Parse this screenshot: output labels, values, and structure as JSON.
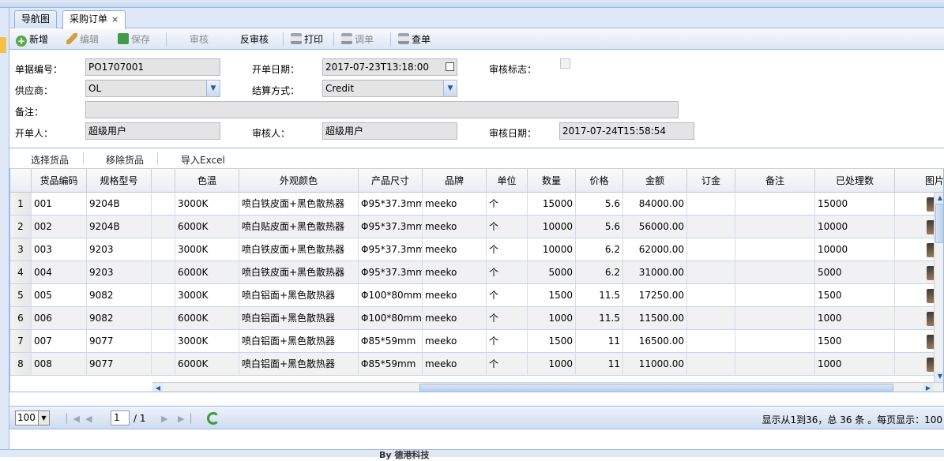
{
  "tabs": [
    {
      "label": "导航图",
      "closable": false
    },
    {
      "label": "采购订单",
      "closable": true
    }
  ],
  "tab_close_glyph": "×",
  "toolbar": {
    "add": "新增",
    "edit": "编辑",
    "save": "保存",
    "audit": "审核",
    "unaudit": "反审核",
    "print": "打印",
    "adjust": "调单",
    "query": "查单"
  },
  "form": {
    "doc_no_label": "单据编号：",
    "doc_no": "PO1707001",
    "open_date_label": "开单日期：",
    "open_date": "2017-07-23T13:18:00",
    "audit_flag_label": "审核标志：",
    "supplier_label": "供应商：",
    "supplier": "OL",
    "settle_label": "结算方式：",
    "settle": "Credit",
    "remark_label": "备注：",
    "remark": "",
    "creator_label": "开单人：",
    "creator": "超级用户",
    "auditor_label": "审核人：",
    "auditor": "超级用户",
    "audit_date_label": "审核日期：",
    "audit_date": "2017-07-24T15:58:54"
  },
  "grid_toolbar": {
    "select": "选择货品",
    "remove": "移除货品",
    "import": "导入Excel"
  },
  "grid": {
    "headers": [
      "",
      "货品编码",
      "规格型号",
      "",
      "色温",
      "外观颜色",
      "产品尺寸",
      "品牌",
      "单位",
      "数量",
      "价格",
      "金额",
      "订金",
      "备注",
      "已处理数",
      "图片"
    ],
    "rows": [
      {
        "n": "1",
        "code": "001",
        "model": "9204B",
        "temp": "3000K",
        "color": "喷白铁皮面+黑色散热器",
        "size": "Φ95*37.3mm",
        "brand": "meeko",
        "unit": "个",
        "qty": "15000",
        "price": "5.6",
        "amount": "84000.00",
        "deposit": "",
        "remark": "",
        "done": "15000"
      },
      {
        "n": "2",
        "code": "002",
        "model": "9204B",
        "temp": "6000K",
        "color": "喷白贴皮面+黑色散热器",
        "size": "Φ95*37.3mm",
        "brand": "meeko",
        "unit": "个",
        "qty": "10000",
        "price": "5.6",
        "amount": "56000.00",
        "deposit": "",
        "remark": "",
        "done": "10000"
      },
      {
        "n": "3",
        "code": "003",
        "model": "9203",
        "temp": "3000K",
        "color": "喷白铁皮面+黑色散热器",
        "size": "Φ95*37.3mm",
        "brand": "meeko",
        "unit": "个",
        "qty": "10000",
        "price": "6.2",
        "amount": "62000.00",
        "deposit": "",
        "remark": "",
        "done": "10000"
      },
      {
        "n": "4",
        "code": "004",
        "model": "9203",
        "temp": "6000K",
        "color": "喷白铁皮面+黑色散热器",
        "size": "Φ95*37.3mm",
        "brand": "meeko",
        "unit": "个",
        "qty": "5000",
        "price": "6.2",
        "amount": "31000.00",
        "deposit": "",
        "remark": "",
        "done": "5000"
      },
      {
        "n": "5",
        "code": "005",
        "model": "9082",
        "temp": "3000K",
        "color": "喷白铝面+黑色散热器",
        "size": "Φ100*80mm",
        "brand": "meeko",
        "unit": "个",
        "qty": "1500",
        "price": "11.5",
        "amount": "17250.00",
        "deposit": "",
        "remark": "",
        "done": "1500"
      },
      {
        "n": "6",
        "code": "006",
        "model": "9082",
        "temp": "6000K",
        "color": "喷白铝面+黑色散热器",
        "size": "Φ100*80mm",
        "brand": "meeko",
        "unit": "个",
        "qty": "1000",
        "price": "11.5",
        "amount": "11500.00",
        "deposit": "",
        "remark": "",
        "done": "1000"
      },
      {
        "n": "7",
        "code": "007",
        "model": "9077",
        "temp": "3000K",
        "color": "喷白铝面+黑色散热器",
        "size": "Φ85*59mm",
        "brand": "meeko",
        "unit": "个",
        "qty": "1500",
        "price": "11",
        "amount": "16500.00",
        "deposit": "",
        "remark": "",
        "done": "1500"
      },
      {
        "n": "8",
        "code": "008",
        "model": "9077",
        "temp": "6000K",
        "color": "喷白铝面+黑色散热器",
        "size": "Φ85*59mm",
        "brand": "meeko",
        "unit": "个",
        "qty": "1000",
        "price": "11",
        "amount": "11000.00",
        "deposit": "",
        "remark": "",
        "done": "1000"
      }
    ]
  },
  "pager": {
    "page_size": "100",
    "page": "1",
    "total_pages": "/ 1",
    "summary": "显示从1到36，总 36 条 。每页显示：100"
  },
  "footer": "By 德港科技"
}
